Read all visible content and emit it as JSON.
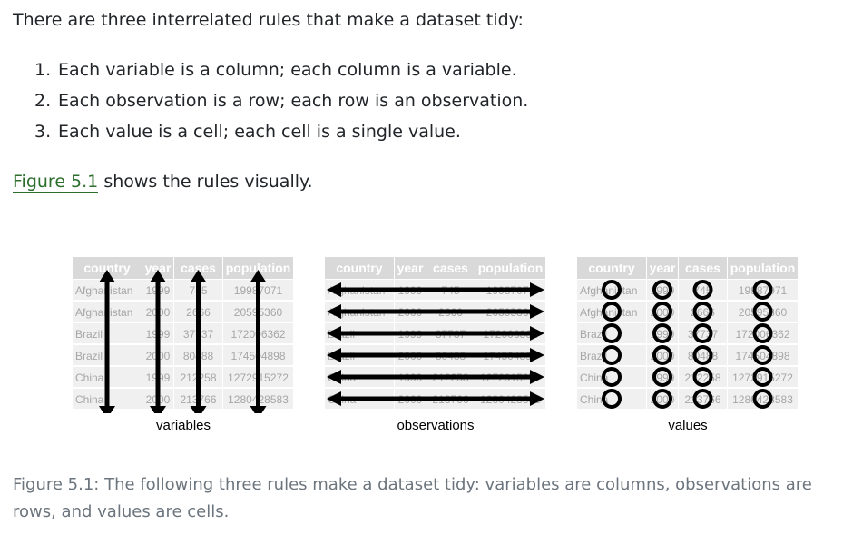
{
  "intro": "There are three interrelated rules that make a dataset tidy:",
  "rules": [
    {
      "num": "1.",
      "text": "Each variable is a column; each column is a variable."
    },
    {
      "num": "2.",
      "text": "Each observation is a row; each row is an observation."
    },
    {
      "num": "3.",
      "text": "Each value is a cell; each cell is a single value."
    }
  ],
  "figref": {
    "link": "Figure 5.1",
    "rest": " shows the rules visually."
  },
  "table": {
    "headers": [
      "country",
      "year",
      "cases",
      "population"
    ],
    "rows": [
      [
        "Afghanistan",
        "1999",
        "745",
        "19987071"
      ],
      [
        "Afghanistan",
        "2000",
        "2666",
        "20595360"
      ],
      [
        "Brazil",
        "1999",
        "37737",
        "172006362"
      ],
      [
        "Brazil",
        "2000",
        "80488",
        "174504898"
      ],
      [
        "China",
        "1999",
        "212258",
        "1272915272"
      ],
      [
        "China",
        "2000",
        "213766",
        "1280428583"
      ]
    ]
  },
  "panels": {
    "variables": "variables",
    "observations": "observations",
    "values": "values"
  },
  "colors": {
    "header_bg": "#d9d9d9",
    "header_text": "#ffffff",
    "row_bg": "#f0f0f0",
    "cell_text": "#a6a6a6",
    "arrow": "#000000",
    "link": "#2c6e2c",
    "caption": "#6c757d"
  },
  "caption": "Figure 5.1: The following three rules make a dataset tidy: variables are columns, observations are rows, and values are cells."
}
